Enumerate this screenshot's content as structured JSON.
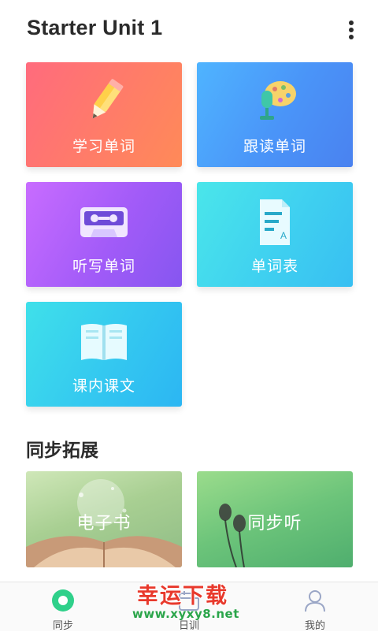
{
  "header": {
    "title": "Starter Unit 1",
    "more_icon": "more-vertical-icon"
  },
  "tiles": [
    {
      "label": "学习单词",
      "icon": "pencil-icon",
      "color": "#ff7466"
    },
    {
      "label": "跟读单词",
      "icon": "microphone-icon",
      "color": "#4a94f8"
    },
    {
      "label": "听写单词",
      "icon": "cassette-icon",
      "color": "#a25bf8"
    },
    {
      "label": "单词表",
      "icon": "document-icon",
      "color": "#3fd0f0"
    },
    {
      "label": "课内课文",
      "icon": "book-icon",
      "color": "#34c8f0"
    }
  ],
  "extension": {
    "title": "同步拓展",
    "cards": [
      {
        "label": "电子书"
      },
      {
        "label": "同步听"
      }
    ]
  },
  "tabbar": {
    "items": [
      {
        "label": "同步",
        "icon": "sync-circle-icon",
        "active": true
      },
      {
        "label": "日训",
        "icon": "calendar-icon",
        "active": false
      },
      {
        "label": "我的",
        "icon": "user-icon",
        "active": false
      }
    ]
  },
  "watermark": {
    "title": "幸运下载",
    "url": "www.xyxy8.net"
  }
}
